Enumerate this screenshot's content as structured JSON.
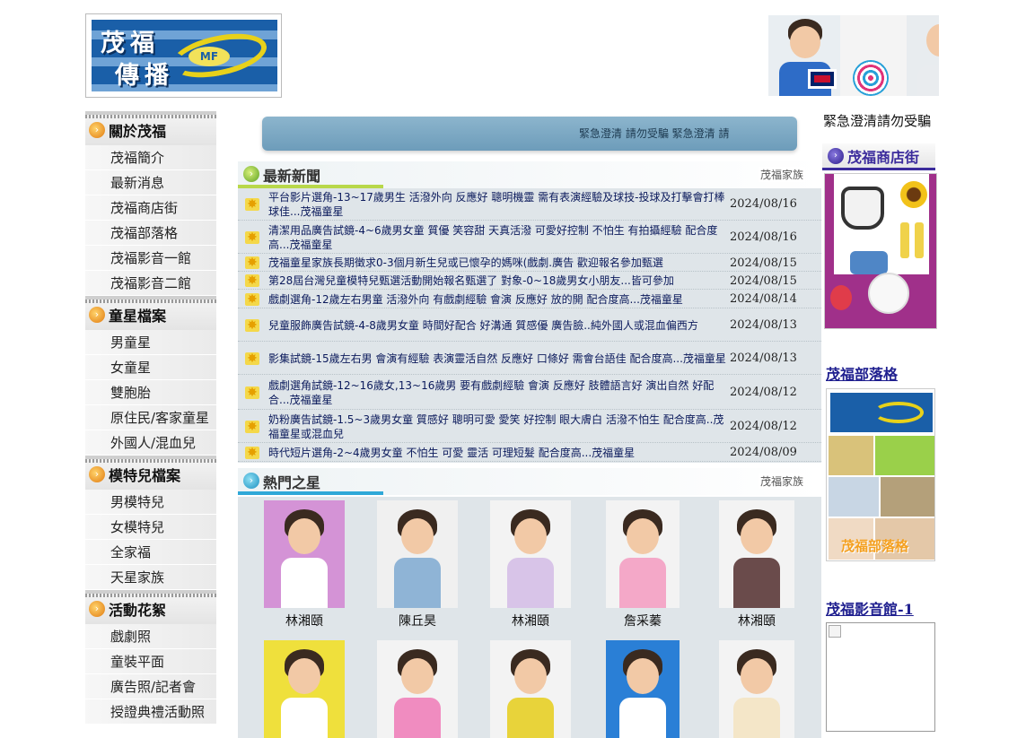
{
  "logo": {
    "line1": "茂福",
    "line2": "傳播",
    "badge": "MF"
  },
  "leftnav": [
    {
      "title": "關於茂福",
      "items": [
        "茂福簡介",
        "最新消息",
        "茂福商店街",
        "茂福部落格",
        "茂福影音一館",
        "茂福影音二館"
      ]
    },
    {
      "title": "童星檔案",
      "items": [
        "男童星",
        "女童星",
        "雙胞胎",
        "原住民/客家童星",
        "外國人/混血兒"
      ]
    },
    {
      "title": "模特兒檔案",
      "items": [
        "男模特兒",
        "女模特兒",
        "全家福",
        "天星家族"
      ]
    },
    {
      "title": "活動花絮",
      "items": [
        "戲劇照",
        "童裝平面",
        "廣告照/記者會",
        "授證典禮活動照"
      ]
    }
  ],
  "marquee": "緊急澄清 請勿受騙   緊急澄清 請",
  "news_section": {
    "title": "最新新聞",
    "family": "茂福家族"
  },
  "news": [
    {
      "title": "平台影片選角-13~17歲男生 活潑外向 反應好 聰明機靈 需有表演經驗及球技-投球及打擊會打棒球佳...茂福童星",
      "date": "2024/08/16"
    },
    {
      "title": "清潔用品廣告試鏡-4~6歲男女童 質優 笑容甜 天真活潑 可愛好控制 不怕生 有拍攝經驗 配合度高...茂福童星",
      "date": "2024/08/16"
    },
    {
      "title": "茂福童星家族長期徵求0-3個月新生兒或已懷孕的媽咪(戲劇.廣告 歡迎報名參加甄選",
      "date": "2024/08/15"
    },
    {
      "title": "第28屆台灣兒童模特兒甄選活動開始報名甄選了 對象-0~18歲男女小朋友...皆可參加",
      "date": "2024/08/15"
    },
    {
      "title": "戲劇選角-12歲左右男童 活潑外向 有戲劇經驗 會演 反應好 放的開 配合度高...茂福童星",
      "date": "2024/08/14"
    },
    {
      "title": "兒童服飾廣告試鏡-4-8歲男女童 時間好配合 好溝通 質感優 廣告臉..純外國人或混血偏西方",
      "date": "2024/08/13"
    },
    {
      "title": "影集試鏡-15歲左右男 會演有經驗 表演靈活自然 反應好 口條好 需會台語佳 配合度高...茂福童星",
      "date": "2024/08/13"
    },
    {
      "title": "戲劇選角試鏡-12~16歲女,13~16歲男 要有戲劇經驗 會演 反應好 肢體語言好 演出自然 好配合...茂福童星",
      "date": "2024/08/12"
    },
    {
      "title": "奶粉廣告試鏡-1.5~3歲男女童 質感好 聰明可愛 愛笑 好控制 眼大膚白 活潑不怕生 配合度高..茂福童星或混血兒",
      "date": "2024/08/12"
    },
    {
      "title": "時代短片選角-2~4歲男女童 不怕生 可愛 靈活 可理短髮 配合度高...茂福童星",
      "date": "2024/08/09"
    }
  ],
  "stars_section": {
    "title": "熱門之星",
    "family": "茂福家族"
  },
  "stars": [
    {
      "name": "林湘頤",
      "bg": "#d493d6",
      "shirt": "#ffffff"
    },
    {
      "name": "陳丘昊",
      "bg": "#f0f0f0",
      "shirt": "#8fb4d6"
    },
    {
      "name": "林湘頤",
      "bg": "#f3f3f3",
      "shirt": "#d8c4e8"
    },
    {
      "name": "詹采蓁",
      "bg": "#f3f3f3",
      "shirt": "#f4a8c8"
    },
    {
      "name": "林湘頤",
      "bg": "#f3f3f3",
      "shirt": "#6a4b4b"
    },
    {
      "name": "",
      "bg": "#efe03c",
      "shirt": "#ffffff"
    },
    {
      "name": "",
      "bg": "#f3f3f3",
      "shirt": "#f08cc0"
    },
    {
      "name": "",
      "bg": "#f3f3f3",
      "shirt": "#e8d33a"
    },
    {
      "name": "",
      "bg": "#2a7fd6",
      "shirt": "#ffffff"
    },
    {
      "name": "",
      "bg": "#f3f3f3",
      "shirt": "#f4e6c8"
    }
  ],
  "right": {
    "notice": "緊急澄清請勿受騙",
    "shop_title": "茂福商店街",
    "blog_link": "茂福部落格",
    "blog_badge": "茂福部落格",
    "video_link": "茂福影音館-1"
  }
}
